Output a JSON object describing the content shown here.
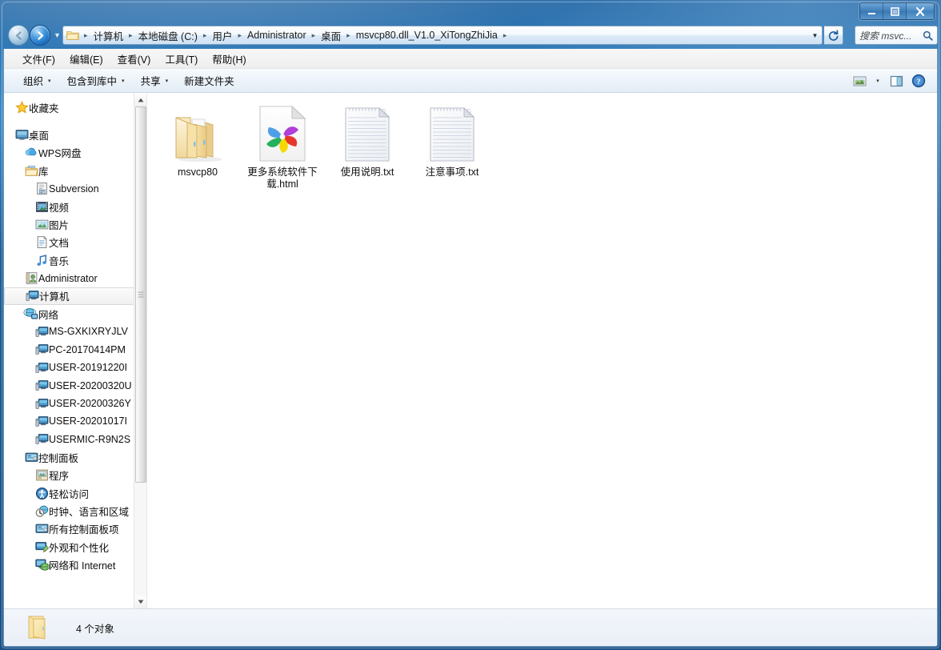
{
  "window": {
    "minimize_label": "minimize",
    "maximize_label": "maximize",
    "close_label": "close"
  },
  "nav": {
    "back_label": "后退",
    "forward_label": "前进",
    "history_label": "最近浏览的位置",
    "refresh_label": "刷新"
  },
  "address": {
    "crumbs": [
      "计算机",
      "本地磁盘 (C:)",
      "用户",
      "Administrator",
      "桌面",
      "msvcp80.dll_V1.0_XiTongZhiJia"
    ],
    "separator": "▸"
  },
  "search": {
    "placeholder": "搜索 msvc...",
    "value": "搜索 msvc..."
  },
  "menubar": {
    "items": [
      {
        "label": "文件(F)"
      },
      {
        "label": "编辑(E)"
      },
      {
        "label": "查看(V)"
      },
      {
        "label": "工具(T)"
      },
      {
        "label": "帮助(H)"
      }
    ]
  },
  "commandbar": {
    "items": [
      {
        "label": "组织",
        "caret": "▾"
      },
      {
        "label": "包含到库中",
        "caret": "▾"
      },
      {
        "label": "共享",
        "caret": "▾"
      },
      {
        "label": "新建文件夹",
        "caret": ""
      }
    ],
    "view_label": "更改您的视图",
    "view_caret": "▾",
    "preview_label": "显示预览窗格",
    "help_label": "获取帮助"
  },
  "sidebar": {
    "items": [
      {
        "label": "收藏夹",
        "icon": "star-icon",
        "indent": 0,
        "selected": false
      },
      {
        "label": "",
        "icon": "gap",
        "indent": 0,
        "selected": false
      },
      {
        "label": "桌面",
        "icon": "desktop-icon",
        "indent": 0,
        "selected": false
      },
      {
        "label": "WPS网盘",
        "icon": "cloud-icon",
        "indent": 1,
        "selected": false
      },
      {
        "label": "库",
        "icon": "library-icon",
        "indent": 1,
        "selected": false
      },
      {
        "label": "Subversion",
        "icon": "subversion-icon",
        "indent": 2,
        "selected": false
      },
      {
        "label": "视频",
        "icon": "video-icon",
        "indent": 2,
        "selected": false
      },
      {
        "label": "图片",
        "icon": "pictures-icon",
        "indent": 2,
        "selected": false
      },
      {
        "label": "文档",
        "icon": "documents-icon",
        "indent": 2,
        "selected": false
      },
      {
        "label": "音乐",
        "icon": "music-icon",
        "indent": 2,
        "selected": false
      },
      {
        "label": "Administrator",
        "icon": "user-icon",
        "indent": 1,
        "selected": false
      },
      {
        "label": "计算机",
        "icon": "computer-icon",
        "indent": 1,
        "selected": true
      },
      {
        "label": "网络",
        "icon": "network-icon",
        "indent": 1,
        "selected": false
      },
      {
        "label": "MS-GXKIXRYJLV",
        "icon": "pc-icon",
        "indent": 2,
        "selected": false
      },
      {
        "label": "PC-20170414PM",
        "icon": "pc-icon",
        "indent": 2,
        "selected": false
      },
      {
        "label": "USER-20191220I",
        "icon": "pc-icon",
        "indent": 2,
        "selected": false
      },
      {
        "label": "USER-20200320U",
        "icon": "pc-icon",
        "indent": 2,
        "selected": false
      },
      {
        "label": "USER-20200326Y",
        "icon": "pc-icon",
        "indent": 2,
        "selected": false
      },
      {
        "label": "USER-20201017I",
        "icon": "pc-icon",
        "indent": 2,
        "selected": false
      },
      {
        "label": "USERMIC-R9N2S",
        "icon": "pc-icon",
        "indent": 2,
        "selected": false
      },
      {
        "label": "控制面板",
        "icon": "controlpanel-icon",
        "indent": 1,
        "selected": false
      },
      {
        "label": "程序",
        "icon": "programs-icon",
        "indent": 2,
        "selected": false
      },
      {
        "label": "轻松访问",
        "icon": "ease-icon",
        "indent": 2,
        "selected": false
      },
      {
        "label": "时钟、语言和区域",
        "icon": "clock-icon",
        "indent": 2,
        "selected": false
      },
      {
        "label": "所有控制面板项",
        "icon": "allitems-icon",
        "indent": 2,
        "selected": false
      },
      {
        "label": "外观和个性化",
        "icon": "appearance-icon",
        "indent": 2,
        "selected": false
      },
      {
        "label": "网络和 Internet",
        "icon": "internet-icon",
        "indent": 2,
        "selected": false
      }
    ]
  },
  "files": [
    {
      "name": "msvcp80",
      "icon": "folder-icon"
    },
    {
      "name": "更多系统软件下载.html",
      "icon": "html-chrome-icon"
    },
    {
      "name": "使用说明.txt",
      "icon": "text-file-icon"
    },
    {
      "name": "注意事项.txt",
      "icon": "text-file-icon"
    }
  ],
  "statusbar": {
    "icon": "folder-icon",
    "text": "4 个对象"
  },
  "colors": {
    "accent": "#2f77b5",
    "folder_yellow": "#f6dd9a",
    "selection_blue": "#cfe5f8"
  }
}
